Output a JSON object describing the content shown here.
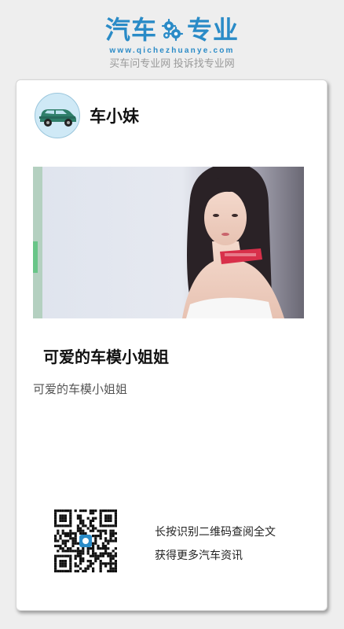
{
  "brand": {
    "logo_part1": "汽车",
    "logo_part2": "专业",
    "url": "www.qichezhuanye.com",
    "slogan": "买车问专业网 投诉找专业网",
    "color": "#2a8bc7"
  },
  "author": {
    "name": "车小妹",
    "avatar_icon": "car-avatar-icon"
  },
  "article": {
    "title": "可爱的车模小姐姐",
    "summary": "可爱的车模小姐姐"
  },
  "qr": {
    "line1": "长按识别二维码查阅全文",
    "line2": "获得更多汽车资讯"
  }
}
